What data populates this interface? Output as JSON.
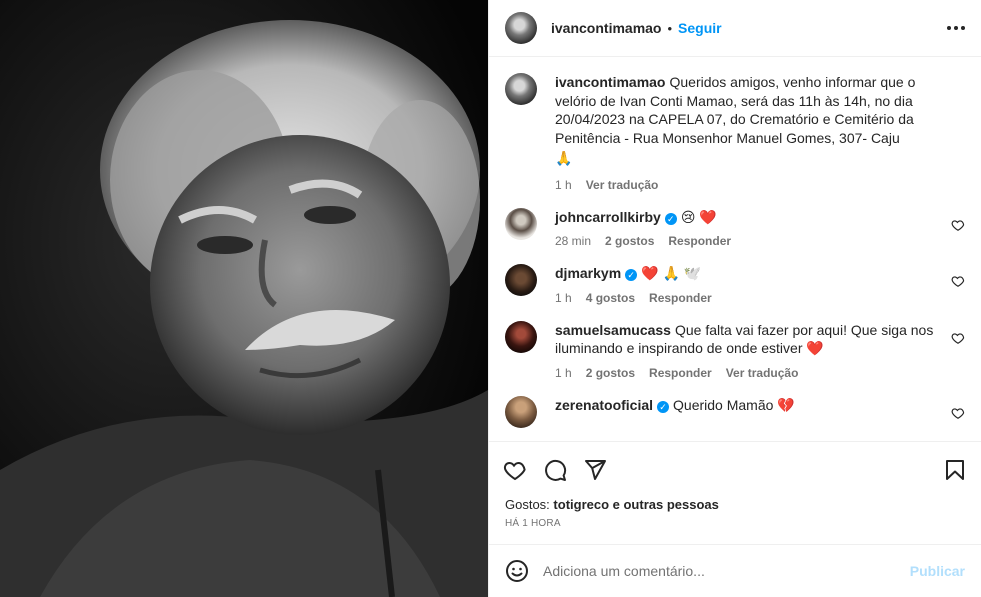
{
  "post": {
    "username": "ivancontimamao",
    "follow_label": "Seguir",
    "separator": "•"
  },
  "caption": {
    "username": "ivancontimamao",
    "text": "Queridos amigos, venho informar que o velório de Ivan Conti Mamao, será das 11h às 14h, no dia 20/04/2023 na CAPELA 07, do Crematório e Cemitério da Penitência - Rua Monsenhor Manuel Gomes, 307- Caju",
    "emoji": "🙏",
    "time": "1 h",
    "translate": "Ver tradução"
  },
  "comments": [
    {
      "username": "johncarrollkirby",
      "verified": true,
      "text": "😢 ❤️",
      "time": "28 min",
      "likes": "2 gostos",
      "reply": "Responder",
      "translate": ""
    },
    {
      "username": "djmarkym",
      "verified": true,
      "text": "❤️ 🙏 🕊️",
      "time": "1 h",
      "likes": "4 gostos",
      "reply": "Responder",
      "translate": ""
    },
    {
      "username": "samuelsamucass",
      "verified": false,
      "text": "Que falta vai fazer por aqui! Que siga nos iluminando e inspirando de onde estiver ❤️",
      "time": "1 h",
      "likes": "2 gostos",
      "reply": "Responder",
      "translate": "Ver tradução"
    },
    {
      "username": "zerenatooficial",
      "verified": true,
      "text": "Querido Mamão 💔",
      "time": "",
      "likes": "",
      "reply": "",
      "translate": ""
    }
  ],
  "likes": {
    "prefix": "Gostos:",
    "text": "totigreco e outras pessoas",
    "time": "HÁ 1 HORA"
  },
  "add_comment": {
    "placeholder": "Adiciona um comentário...",
    "publish": "Publicar"
  },
  "icons": [
    "more-icon",
    "heart-icon",
    "comment-icon",
    "share-icon",
    "bookmark-icon",
    "emoji-icon",
    "verified-icon"
  ],
  "colors": {
    "accent": "#0095f6",
    "publish_disabled": "#b2dffc",
    "muted": "#737373"
  }
}
